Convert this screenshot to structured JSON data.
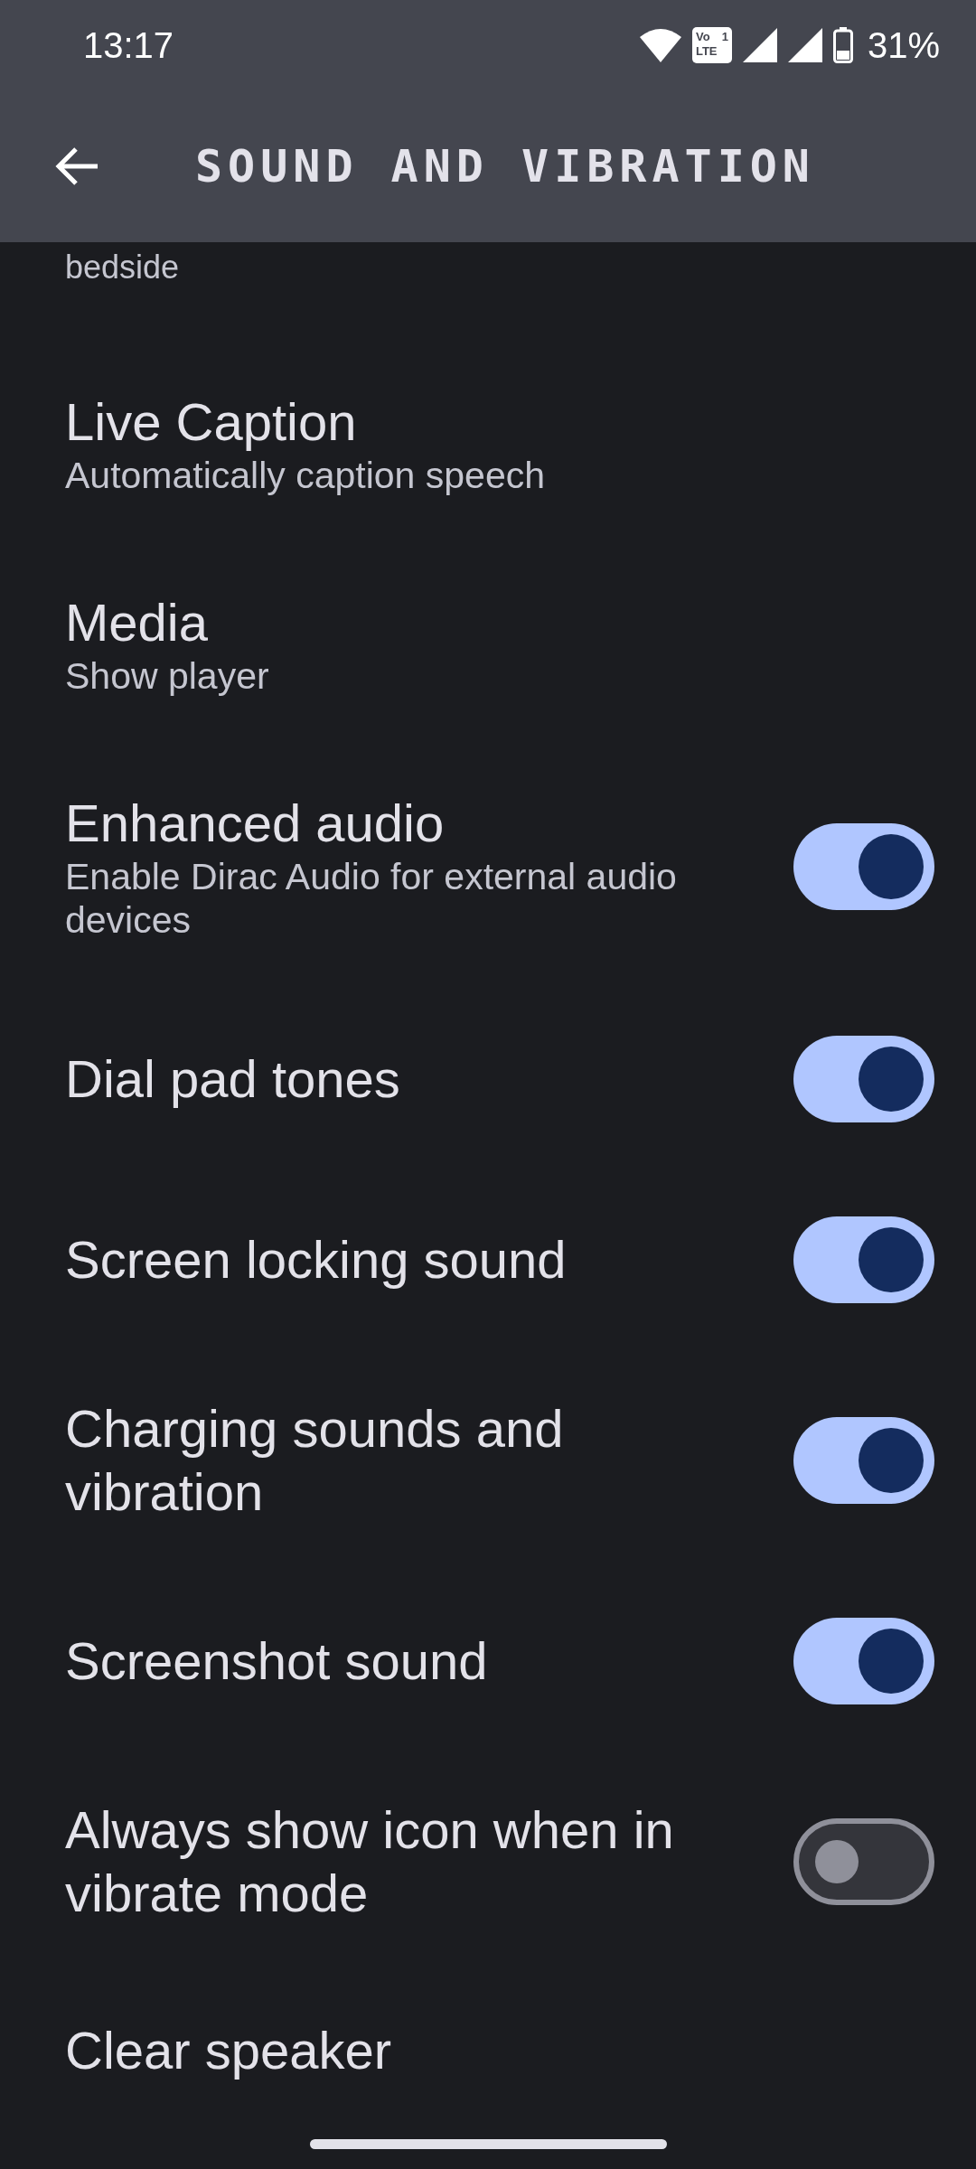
{
  "status_bar": {
    "time": "13:17",
    "volte": {
      "top": "Vo",
      "sim": "1",
      "bottom": "LTE"
    },
    "battery": "31%"
  },
  "app_bar": {
    "title": "SOUND AND VIBRATION"
  },
  "partial_text": "bedside",
  "settings": [
    {
      "kind": "link",
      "title": "Live Caption",
      "subtitle": "Automatically caption speech"
    },
    {
      "kind": "link",
      "title": "Media",
      "subtitle": "Show player"
    },
    {
      "kind": "toggle",
      "title": "Enhanced audio",
      "subtitle": "Enable Dirac Audio for external audio devices",
      "on": true
    },
    {
      "kind": "toggle",
      "title": "Dial pad tones",
      "on": true
    },
    {
      "kind": "toggle",
      "title": "Screen locking sound",
      "on": true
    },
    {
      "kind": "toggle",
      "title": "Charging sounds and vibration",
      "on": true
    },
    {
      "kind": "toggle",
      "title": "Screenshot sound",
      "on": true
    },
    {
      "kind": "toggle",
      "title": "Always show icon when in vibrate mode",
      "on": false
    },
    {
      "kind": "link",
      "title": "Clear speaker"
    }
  ]
}
